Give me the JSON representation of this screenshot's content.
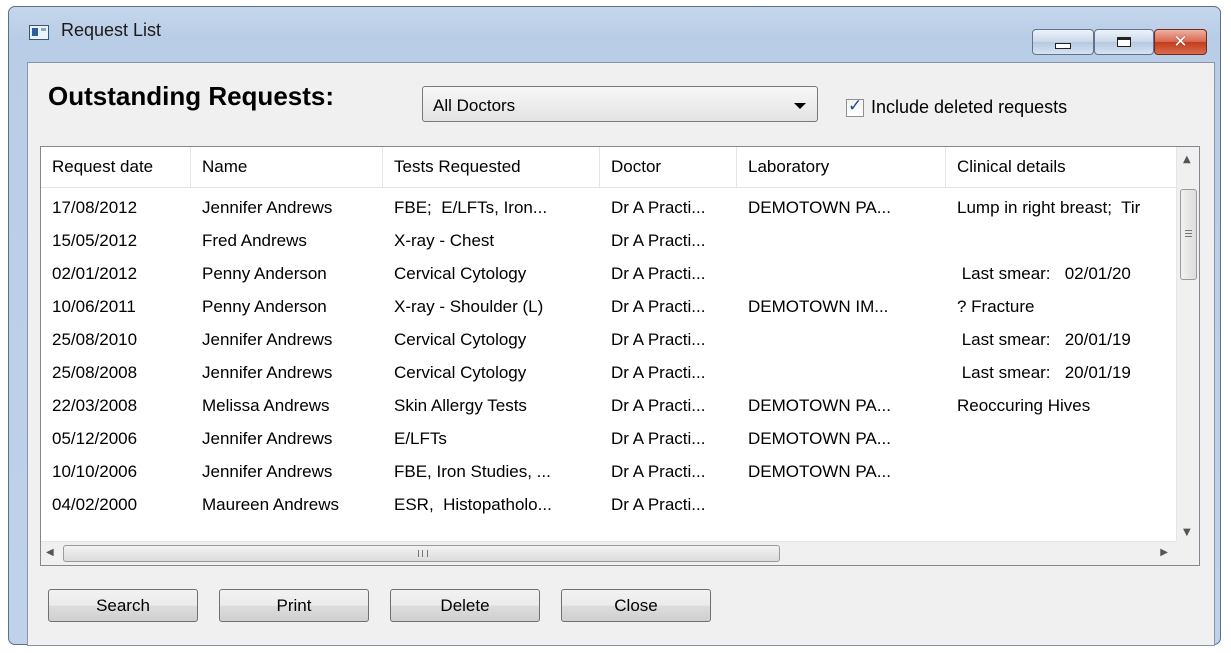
{
  "window": {
    "title": "Request List",
    "minimize_icon": "minimize-icon",
    "maximize_icon": "restore-icon",
    "close_icon": "close-icon",
    "close_glyph": "✕"
  },
  "header": {
    "heading": "Outstanding Requests:",
    "doctor_filter": {
      "selected": "All Doctors"
    },
    "include_deleted": {
      "label": "Include deleted requests",
      "checked": true,
      "check_glyph": "✓"
    }
  },
  "table": {
    "columns": [
      "Request date",
      "Name",
      "Tests Requested",
      "Doctor",
      "Laboratory",
      "Clinical details"
    ],
    "rows": [
      [
        "17/08/2012",
        "Jennifer Andrews",
        "FBE;  E/LFTs, Iron...",
        "Dr A Practi...",
        "DEMOTOWN PA...",
        "Lump in right breast;  Tir"
      ],
      [
        "15/05/2012",
        "Fred Andrews",
        "X-ray - Chest",
        "Dr A Practi...",
        "",
        ""
      ],
      [
        "02/01/2012",
        "Penny Anderson",
        "Cervical Cytology",
        "Dr A Practi...",
        "",
        " Last smear:   02/01/20"
      ],
      [
        "10/06/2011",
        "Penny Anderson",
        "X-ray - Shoulder (L)",
        "Dr A Practi...",
        "DEMOTOWN IM...",
        "? Fracture"
      ],
      [
        "25/08/2010",
        "Jennifer Andrews",
        "Cervical Cytology",
        "Dr A Practi...",
        "",
        " Last smear:   20/01/19"
      ],
      [
        "25/08/2008",
        "Jennifer Andrews",
        "Cervical Cytology",
        "Dr A Practi...",
        "",
        " Last smear:   20/01/19"
      ],
      [
        "22/03/2008",
        "Melissa Andrews",
        "Skin Allergy Tests",
        "Dr A Practi...",
        "DEMOTOWN PA...",
        "Reoccuring Hives"
      ],
      [
        "05/12/2006",
        "Jennifer Andrews",
        "E/LFTs",
        "Dr A Practi...",
        "DEMOTOWN PA...",
        ""
      ],
      [
        "10/10/2006",
        "Jennifer Andrews",
        "FBE, Iron Studies, ...",
        "Dr A Practi...",
        "DEMOTOWN PA...",
        ""
      ],
      [
        "04/02/2000",
        "Maureen Andrews",
        "ESR,  Histopatholo...",
        "Dr A Practi...",
        "",
        ""
      ]
    ],
    "scroll_up_icon": "scroll-up-arrow-icon",
    "scroll_down_icon": "scroll-down-arrow-icon",
    "scroll_left_icon": "scroll-left-arrow-icon",
    "scroll_right_icon": "scroll-right-arrow-icon"
  },
  "buttons": {
    "search": "Search",
    "print": "Print",
    "delete": "Delete",
    "close": "Close"
  }
}
